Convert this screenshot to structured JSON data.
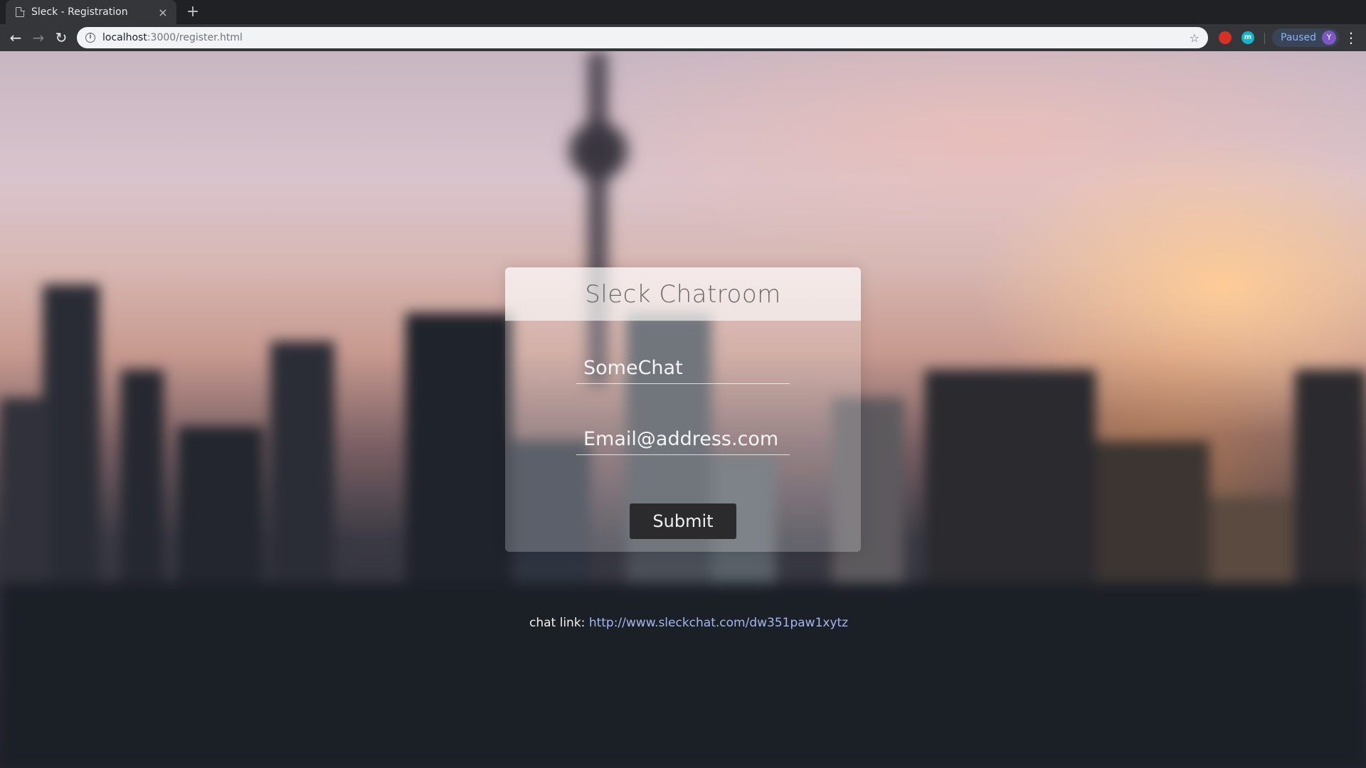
{
  "browser": {
    "tab_title": "Sleck - Registration",
    "tab_close": "×",
    "new_tab": "+",
    "url_host": "localhost",
    "url_rest": ":3000/register.html",
    "profile_status": "Paused",
    "profile_initial": "Y",
    "ext_red_label": "",
    "ext_teal_label": "m"
  },
  "card": {
    "title": "Sleck Chatroom",
    "name_value": "SomeChat",
    "email_placeholder": "Email@address.com",
    "submit_label": "Submit"
  },
  "footer": {
    "chat_link_label": "chat link:",
    "chat_link_url": "http://www.sleckchat.com/dw351paw1xytz"
  }
}
